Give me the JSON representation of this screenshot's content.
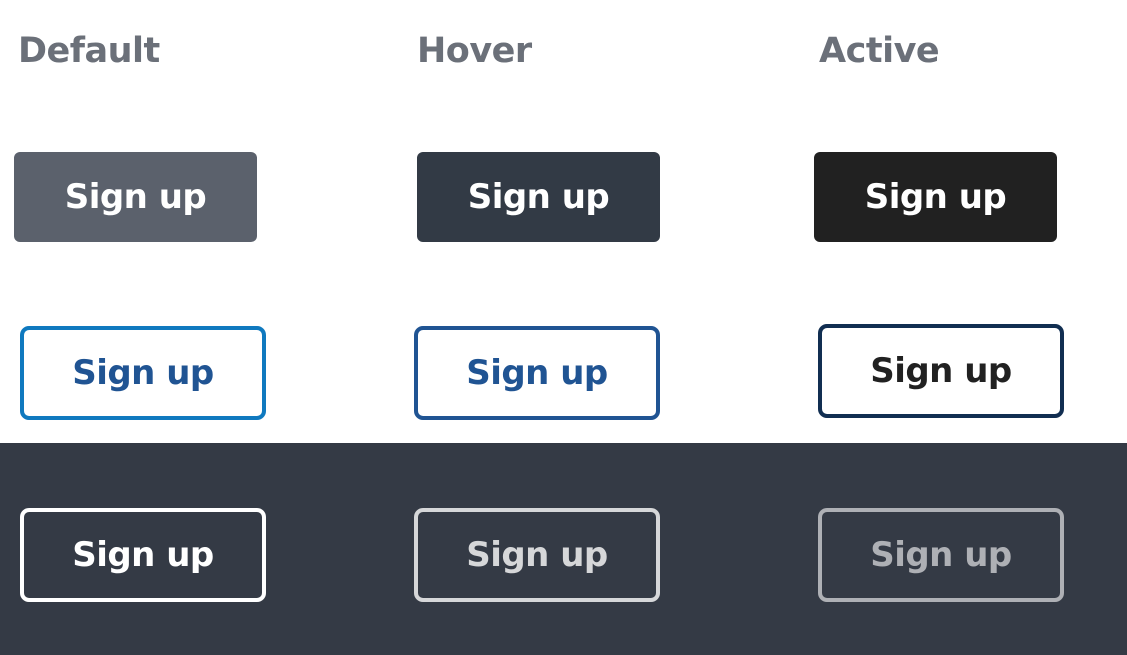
{
  "columns": {
    "default": "Default",
    "hover": "Hover",
    "active": "Active"
  },
  "buttons": {
    "label": "Sign up"
  },
  "colors": {
    "primary_default": "#5b616c",
    "primary_hover": "#323a45",
    "primary_active": "#212121",
    "outline_default": "#0f79bf",
    "outline_hover": "#205493",
    "outline_active": "#112e51",
    "dark_band": "#343a45",
    "inverse_default": "#ffffff",
    "inverse_hover": "#d6d7d9",
    "inverse_active": "#aeb0b5"
  }
}
